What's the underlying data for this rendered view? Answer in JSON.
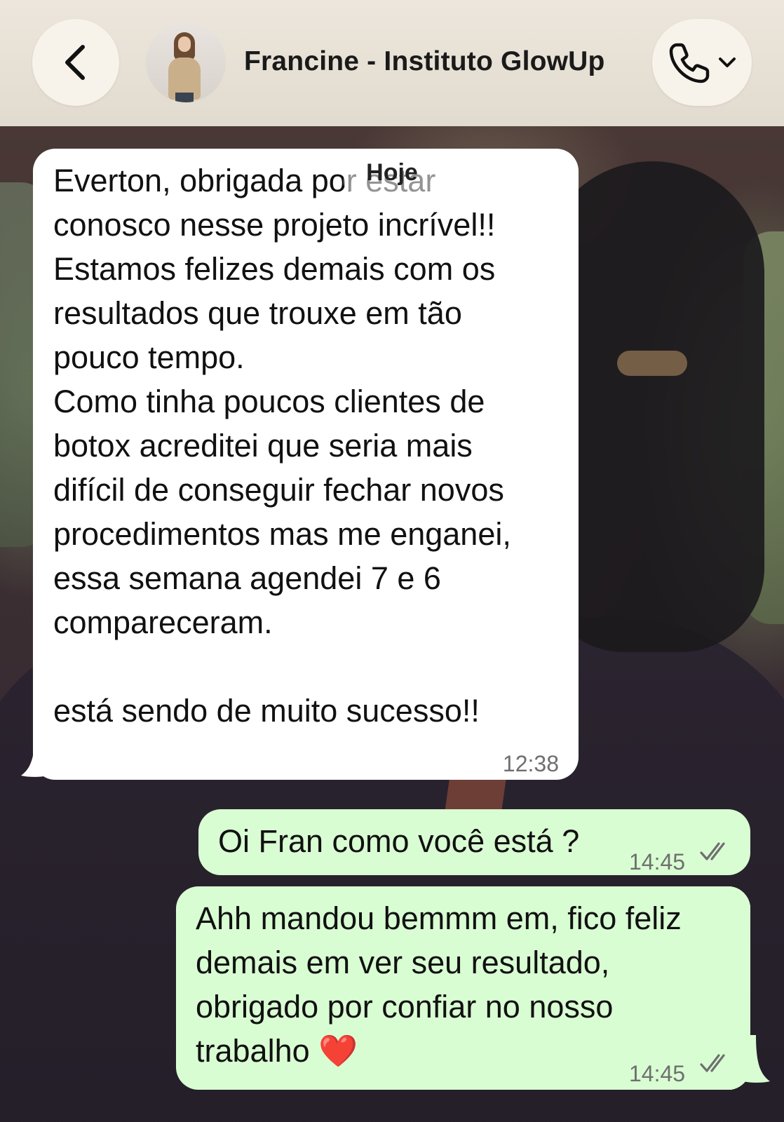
{
  "header": {
    "contact_name": "Francine - Instituto GlowUp"
  },
  "date_separator": "Hoje",
  "messages": [
    {
      "direction": "incoming",
      "text": "Everton, obrigada por estar\nconosco nesse projeto incrível!!\nEstamos felizes demais com os\nresultados que trouxe em tão\npouco tempo.\nComo tinha poucos clientes de\nbotox acreditei que seria mais\ndifícil de conseguir fechar novos\nprocedimentos mas me enganei,\nessa semana agendei 7 e 6\ncompareceram.\n\nestá sendo de muito sucesso!!",
      "time": "12:38"
    },
    {
      "direction": "outgoing",
      "text": "Oi Fran como você está ?",
      "time": "14:45",
      "status": "read"
    },
    {
      "direction": "outgoing",
      "text": "Ahh mandou bemmm em, fico feliz\ndemais em ver seu resultado,\nobrigado por confiar no nosso\ntrabalho ❤️",
      "time": "14:45",
      "status": "read"
    }
  ],
  "icons": {
    "back": "chevron-left-icon",
    "call": "phone-icon",
    "call_menu": "chevron-down-icon",
    "read_receipt": "double-check-icon"
  },
  "colors": {
    "incoming_bubble": "#ffffff",
    "outgoing_bubble": "#d9fdd3",
    "header_bg": "#e6e0d5"
  }
}
